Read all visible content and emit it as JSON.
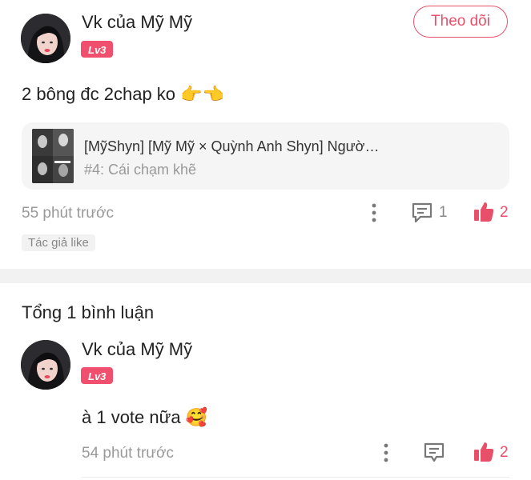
{
  "post": {
    "author_name": "Vk của Mỹ Mỹ",
    "level_badge": "Lv3",
    "follow_label": "Theo dõi",
    "text": "2 bông đc 2chap ko 👉👈",
    "linked_story": {
      "title": "[MỹShyn] [Mỹ Mỹ × Quỳnh Anh Shyn] Ngườ…",
      "chapter": "#4: Cái chạm khẽ"
    },
    "time": "55 phút trước",
    "comment_count": "1",
    "like_count": "2",
    "author_liked_tag": "Tác giả like"
  },
  "comments_section": {
    "total_label": "Tổng 1 bình luận"
  },
  "comments": [
    {
      "author_name": "Vk của Mỹ Mỹ",
      "level_badge": "Lv3",
      "text": "à 1 vote nữa 🥰",
      "time": "54 phút trước",
      "like_count": "2"
    }
  ],
  "colors": {
    "accent": "#e8506a",
    "badge": "#f0506e",
    "muted_text": "#999999"
  },
  "icons": [
    "more-vertical-icon",
    "comment-icon",
    "thumbs-up-icon"
  ]
}
